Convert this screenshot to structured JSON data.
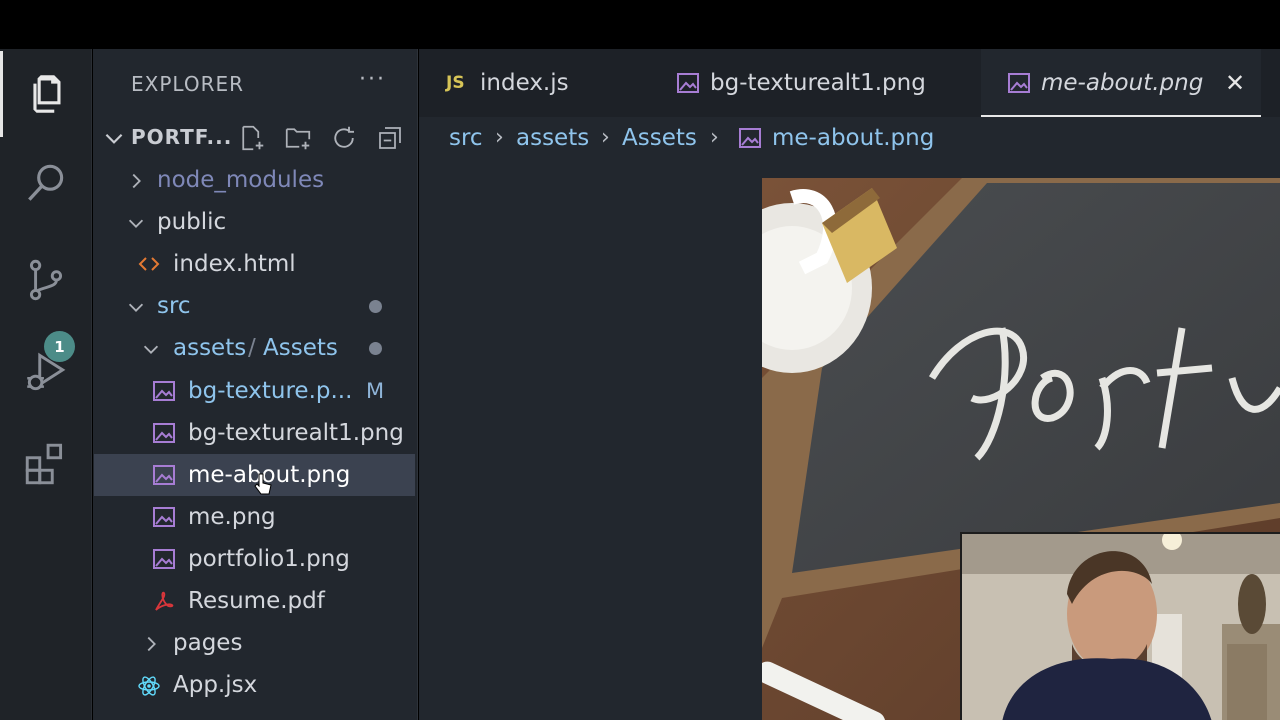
{
  "sidebar": {
    "header": "EXPLORER",
    "more": "···",
    "project": "PORTF...",
    "tree": [
      {
        "label": "node_modules",
        "type": "folder-collapsed"
      },
      {
        "label": "public",
        "type": "folder-open"
      },
      {
        "label": "index.html",
        "type": "html"
      },
      {
        "label": "src",
        "type": "folder-open",
        "modified_dot": true
      },
      {
        "label": "assets",
        "label2": "Assets",
        "type": "folder-open",
        "modified_dot": true
      },
      {
        "label": "bg-texture.p...",
        "type": "image",
        "badge": "M"
      },
      {
        "label": "bg-texturealt1.png",
        "type": "image"
      },
      {
        "label": "me-about.png",
        "type": "image",
        "selected": true
      },
      {
        "label": "me.png",
        "type": "image"
      },
      {
        "label": "portfolio1.png",
        "type": "image"
      },
      {
        "label": "Resume.pdf",
        "type": "pdf"
      },
      {
        "label": "pages",
        "type": "folder-collapsed"
      },
      {
        "label": "App.jsx",
        "type": "react"
      }
    ]
  },
  "activity": {
    "source_control_badge": "1",
    "icons": [
      "files-icon",
      "search-icon",
      "source-control-icon",
      "run-debug-icon",
      "extensions-icon"
    ]
  },
  "tabs": [
    {
      "label": "index.js",
      "icon": "JS"
    },
    {
      "label": "bg-texturealt1.png",
      "icon": "image-icon"
    },
    {
      "label": "me-about.png",
      "icon": "image-icon",
      "active": true,
      "close": "✕"
    }
  ],
  "breadcrumb": [
    "src",
    "assets",
    "Assets",
    "me-about.png"
  ],
  "colors": {
    "accent_blue": "#8fc4ec",
    "image_icon": "#a77dd4",
    "html_icon": "#e37933",
    "pdf_icon": "#d9363b",
    "react_icon": "#61dafb"
  }
}
